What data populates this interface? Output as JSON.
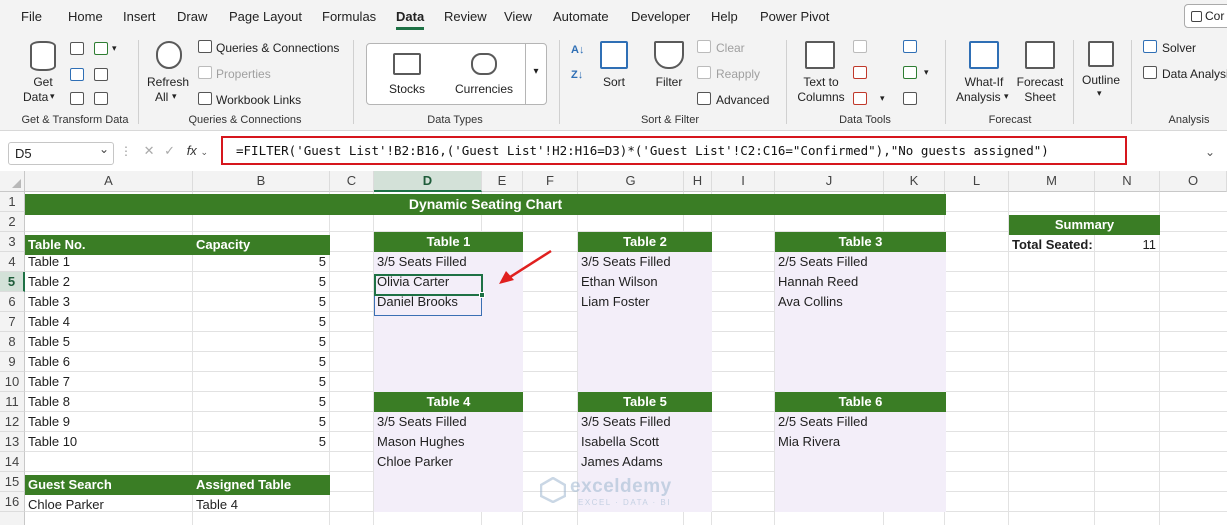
{
  "menu": {
    "tabs": [
      "File",
      "Home",
      "Insert",
      "Draw",
      "Page Layout",
      "Formulas",
      "Data",
      "Review",
      "View",
      "Automate",
      "Developer",
      "Help",
      "Power Pivot"
    ],
    "active": "Data",
    "share_label": "Cor"
  },
  "ribbon": {
    "get_data": "Get",
    "get_data2": "Data",
    "refresh": "Refresh",
    "refresh2": "All",
    "queries_connections": "Queries & Connections",
    "properties": "Properties",
    "workbook_links": "Workbook Links",
    "stocks": "Stocks",
    "currencies": "Currencies",
    "sort": "Sort",
    "filter": "Filter",
    "clear": "Clear",
    "reapply": "Reapply",
    "advanced": "Advanced",
    "text_to_columns": "Text to",
    "text_to_columns2": "Columns",
    "what_if": "What-If",
    "what_if2": "Analysis",
    "forecast_sheet": "Forecast",
    "forecast_sheet2": "Sheet",
    "outline": "Outline",
    "solver": "Solver",
    "data_analysis": "Data Analysis",
    "groups": {
      "get_transform": "Get & Transform Data",
      "queries": "Queries & Connections",
      "data_types": "Data Types",
      "sort_filter": "Sort & Filter",
      "data_tools": "Data Tools",
      "forecast": "Forecast",
      "analysis": "Analysis"
    }
  },
  "formula_bar": {
    "name_box": "D5",
    "fx": "fx",
    "formula": "=FILTER('Guest List'!B2:B16,('Guest List'!H2:H16=D3)*('Guest List'!C2:C16=\"Confirmed\"),\"No guests assigned\")"
  },
  "columns": [
    "A",
    "B",
    "C",
    "D",
    "E",
    "F",
    "G",
    "H",
    "I",
    "J",
    "K",
    "L",
    "M",
    "N",
    "O"
  ],
  "selected_column": "D",
  "selected_row": 5,
  "sheet": {
    "title": "Dynamic Seating Chart",
    "table_header": {
      "no": "Table No.",
      "capacity": "Capacity"
    },
    "tables": [
      {
        "name": "Table 1",
        "capacity": 5
      },
      {
        "name": "Table 2",
        "capacity": 5
      },
      {
        "name": "Table 3",
        "capacity": 5
      },
      {
        "name": "Table 4",
        "capacity": 5
      },
      {
        "name": "Table 5",
        "capacity": 5
      },
      {
        "name": "Table 6",
        "capacity": 5
      },
      {
        "name": "Table 7",
        "capacity": 5
      },
      {
        "name": "Table 8",
        "capacity": 5
      },
      {
        "name": "Table 9",
        "capacity": 5
      },
      {
        "name": "Table 10",
        "capacity": 5
      }
    ],
    "seating": [
      {
        "title": "Table 1",
        "status": "3/5 Seats Filled",
        "guests": [
          "Olivia Carter",
          "Daniel Brooks"
        ]
      },
      {
        "title": "Table 2",
        "status": "3/5 Seats Filled",
        "guests": [
          "Ethan Wilson",
          "Liam Foster"
        ]
      },
      {
        "title": "Table 3",
        "status": "2/5 Seats Filled",
        "guests": [
          "Hannah Reed",
          "Ava Collins"
        ]
      },
      {
        "title": "Table 4",
        "status": "3/5 Seats Filled",
        "guests": [
          "Mason Hughes",
          "Chloe Parker"
        ]
      },
      {
        "title": "Table 5",
        "status": "3/5 Seats Filled",
        "guests": [
          "Isabella Scott",
          "James Adams"
        ]
      },
      {
        "title": "Table 6",
        "status": "2/5 Seats Filled",
        "guests": [
          "Mia Rivera"
        ]
      }
    ],
    "summary": {
      "title": "Summary",
      "label": "Total Seated:",
      "value": 11
    },
    "search": {
      "header": "Guest Search",
      "assigned_header": "Assigned Table",
      "guest": "Chloe Parker",
      "table": "Table 4"
    }
  },
  "watermark": {
    "name": "exceldemy",
    "sub": "EXCEL · DATA · BI"
  }
}
